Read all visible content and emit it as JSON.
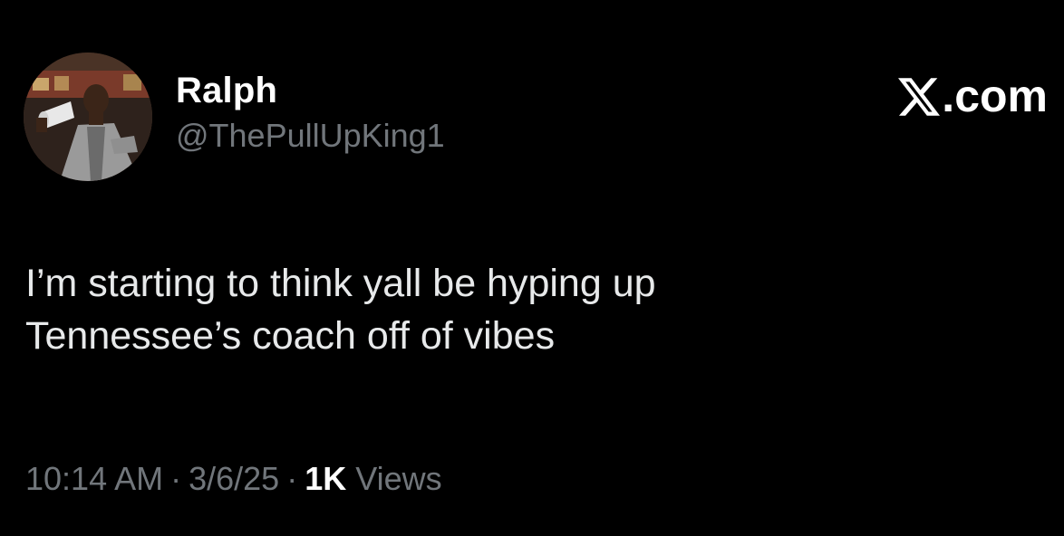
{
  "author": {
    "display_name": "Ralph",
    "handle": "@ThePullUpKing1",
    "avatar_icon": "profile-photo"
  },
  "brand": {
    "label": ".com",
    "icon": "x-logo-icon"
  },
  "tweet": {
    "lines": [
      "I’m starting to think yall be hyping up",
      "Tennessee’s coach off of vibes"
    ]
  },
  "meta": {
    "time": "10:14 AM",
    "separator": "·",
    "date": "3/6/25",
    "views_count": "1K",
    "views_label": "Views"
  },
  "colors": {
    "background": "#000000",
    "primary_text": "#e7e9ea",
    "secondary_text": "#71767b",
    "emphasis": "#ffffff"
  }
}
